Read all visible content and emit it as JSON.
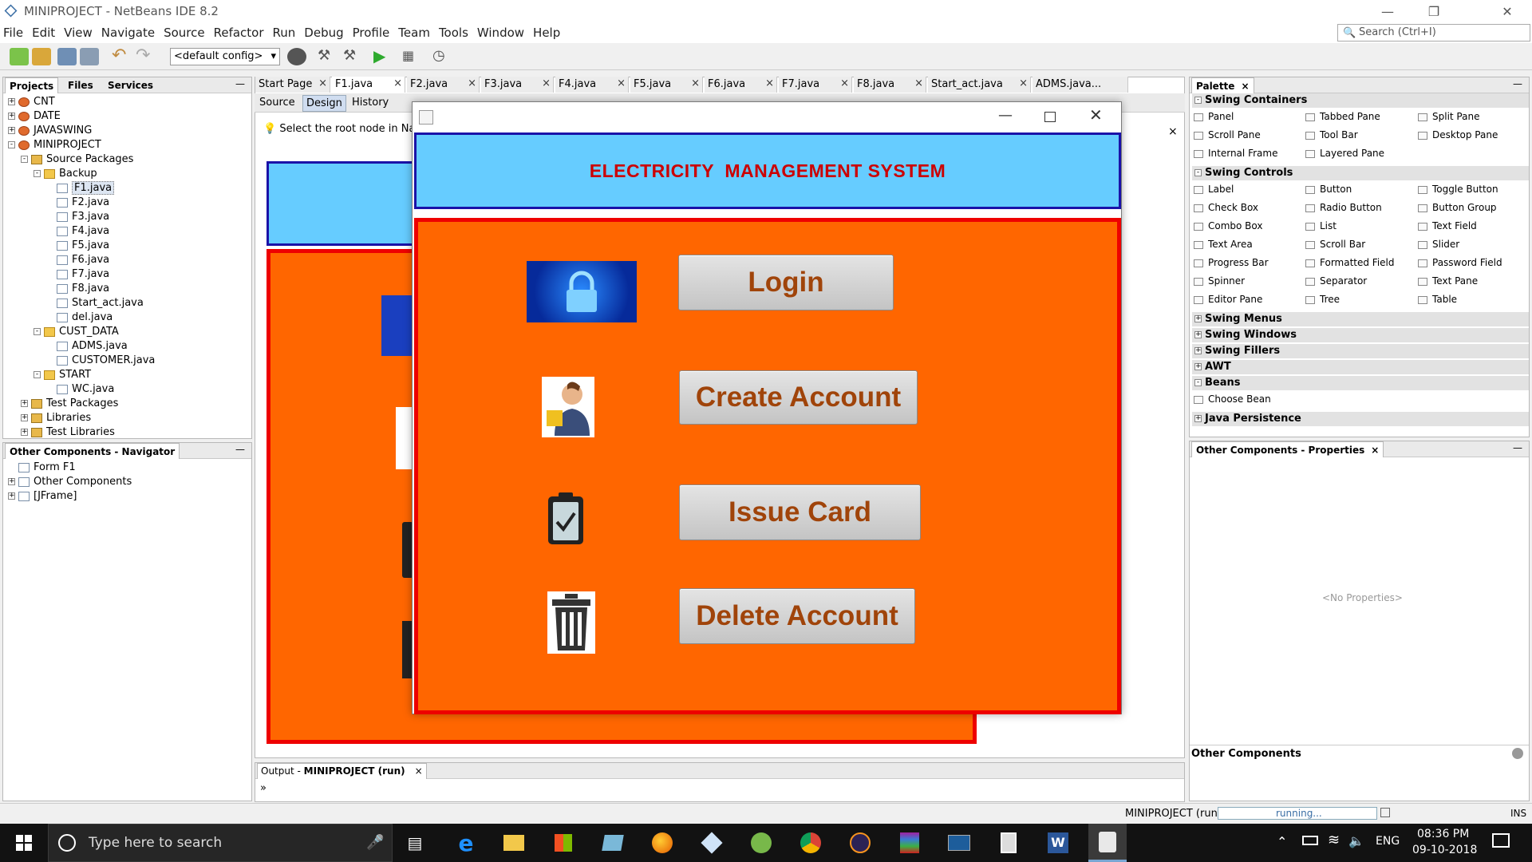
{
  "window": {
    "title": "MINIPROJECT - NetBeans IDE 8.2"
  },
  "menu": [
    "File",
    "Edit",
    "View",
    "Navigate",
    "Source",
    "Refactor",
    "Run",
    "Debug",
    "Profile",
    "Team",
    "Tools",
    "Window",
    "Help"
  ],
  "search": {
    "placeholder": "Search (Ctrl+I)"
  },
  "toolbar": {
    "config": "<default config>"
  },
  "projects_panel": {
    "tabs": [
      "Projects",
      "Files",
      "Services"
    ],
    "tree": [
      {
        "label": "CNT",
        "level": 0,
        "icon": "proj",
        "exp": "+"
      },
      {
        "label": "DATE",
        "level": 0,
        "icon": "proj",
        "exp": "+"
      },
      {
        "label": "JAVASWING",
        "level": 0,
        "icon": "proj",
        "exp": "+"
      },
      {
        "label": "MINIPROJECT",
        "level": 0,
        "icon": "proj",
        "exp": "-"
      },
      {
        "label": "Source Packages",
        "level": 1,
        "icon": "lib",
        "exp": "-"
      },
      {
        "label": "Backup",
        "level": 2,
        "icon": "pkg",
        "exp": "-"
      },
      {
        "label": "F1.java",
        "level": 3,
        "icon": "jav",
        "exp": "",
        "sel": true
      },
      {
        "label": "F2.java",
        "level": 3,
        "icon": "jav",
        "exp": ""
      },
      {
        "label": "F3.java",
        "level": 3,
        "icon": "jav",
        "exp": ""
      },
      {
        "label": "F4.java",
        "level": 3,
        "icon": "jav",
        "exp": ""
      },
      {
        "label": "F5.java",
        "level": 3,
        "icon": "jav",
        "exp": ""
      },
      {
        "label": "F6.java",
        "level": 3,
        "icon": "jav",
        "exp": ""
      },
      {
        "label": "F7.java",
        "level": 3,
        "icon": "jav",
        "exp": ""
      },
      {
        "label": "F8.java",
        "level": 3,
        "icon": "jav",
        "exp": ""
      },
      {
        "label": "Start_act.java",
        "level": 3,
        "icon": "jav",
        "exp": ""
      },
      {
        "label": "del.java",
        "level": 3,
        "icon": "jav",
        "exp": ""
      },
      {
        "label": "CUST_DATA",
        "level": 2,
        "icon": "pkg",
        "exp": "-"
      },
      {
        "label": "ADMS.java",
        "level": 3,
        "icon": "jav",
        "exp": ""
      },
      {
        "label": "CUSTOMER.java",
        "level": 3,
        "icon": "jav",
        "exp": ""
      },
      {
        "label": "START",
        "level": 2,
        "icon": "pkg",
        "exp": "-"
      },
      {
        "label": "WC.java",
        "level": 3,
        "icon": "jav",
        "exp": ""
      },
      {
        "label": "Test Packages",
        "level": 1,
        "icon": "lib",
        "exp": "+"
      },
      {
        "label": "Libraries",
        "level": 1,
        "icon": "lib",
        "exp": "+"
      },
      {
        "label": "Test Libraries",
        "level": 1,
        "icon": "lib",
        "exp": "+"
      }
    ]
  },
  "navigator": {
    "title": "Other Components - Navigator",
    "tree": [
      {
        "label": "Form F1",
        "level": 0,
        "exp": ""
      },
      {
        "label": "Other Components",
        "level": 0,
        "exp": "+"
      },
      {
        "label": "[JFrame]",
        "level": 0,
        "exp": "+"
      }
    ]
  },
  "editor": {
    "tabs": [
      "Start Page",
      "F1.java",
      "F2.java",
      "F3.java",
      "F4.java",
      "F5.java",
      "F6.java",
      "F7.java",
      "F8.java",
      "Start_act.java",
      "ADMS.java..."
    ],
    "subtabs": [
      "Source",
      "Design",
      "History"
    ],
    "hint": "Select the root node in Navig"
  },
  "output": {
    "title_prefix": "Output - ",
    "title_bold": "MINIPROJECT (run)",
    "prompt": "»"
  },
  "palette": {
    "title": "Palette",
    "sections": [
      {
        "name": "Swing Containers",
        "exp": "-",
        "items": [
          "Panel",
          "Tabbed Pane",
          "Split Pane",
          "Scroll Pane",
          "Tool Bar",
          "Desktop Pane",
          "Internal Frame",
          "Layered Pane"
        ]
      },
      {
        "name": "Swing Controls",
        "exp": "-",
        "items": [
          "Label",
          "Button",
          "Toggle Button",
          "Check Box",
          "Radio Button",
          "Button Group",
          "Combo Box",
          "List",
          "Text Field",
          "Text Area",
          "Scroll Bar",
          "Slider",
          "Progress Bar",
          "Formatted Field",
          "Password Field",
          "Spinner",
          "Separator",
          "Text Pane",
          "Editor Pane",
          "Tree",
          "Table"
        ]
      },
      {
        "name": "Swing Menus",
        "exp": "+",
        "items": []
      },
      {
        "name": "Swing Windows",
        "exp": "+",
        "items": []
      },
      {
        "name": "Swing Fillers",
        "exp": "+",
        "items": []
      },
      {
        "name": "AWT",
        "exp": "+",
        "items": []
      },
      {
        "name": "Beans",
        "exp": "-",
        "items": [
          "Choose Bean"
        ]
      },
      {
        "name": "Java Persistence",
        "exp": "+",
        "items": []
      }
    ]
  },
  "properties": {
    "title": "Other Components - Properties",
    "empty": "<No Properties>",
    "footer": "Other Components"
  },
  "status": {
    "project": "MINIPROJECT (run)",
    "progress": "running...",
    "mode": "INS"
  },
  "app": {
    "title": "ELECTRICITY  MANAGEMENT SYSTEM",
    "buttons": [
      "Login",
      "Create Account",
      "Issue Card",
      "Delete Account"
    ]
  },
  "taskbar": {
    "search": "Type here to search",
    "lang": "ENG",
    "time": "08:36 PM",
    "date": "09-10-2018"
  },
  "colors": {
    "header": "#66ccff",
    "panel": "#ff6600",
    "border_red": "#ee0000",
    "title_red": "#cc0000",
    "button_text": "#a0440a"
  }
}
